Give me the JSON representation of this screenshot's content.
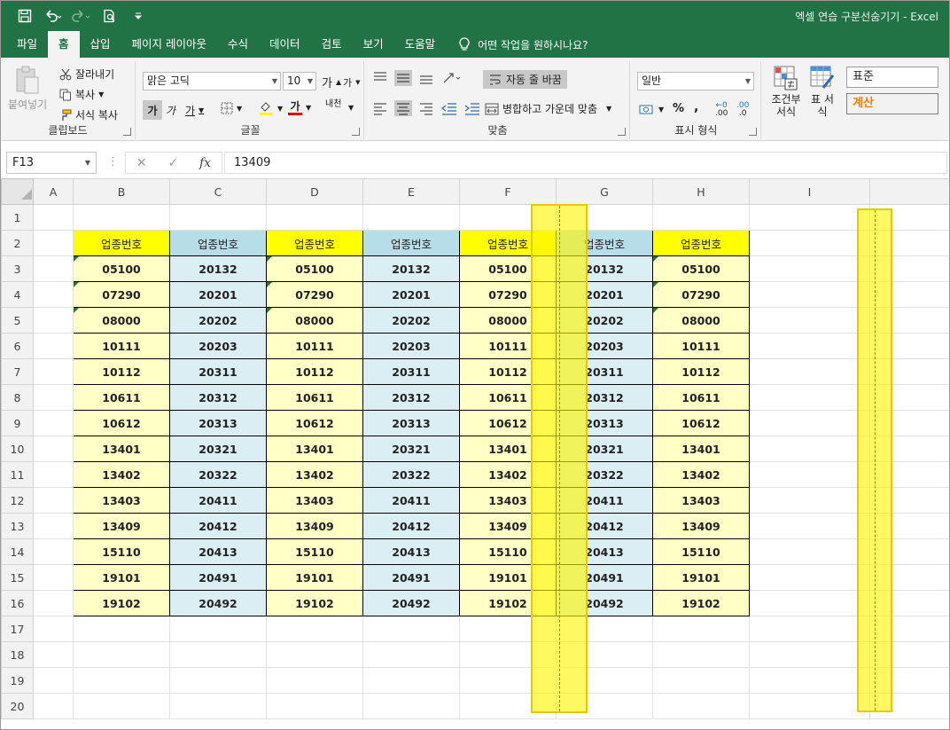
{
  "window": {
    "title": "엑셀 연습 구분선숨기기 - Excel"
  },
  "tabs": [
    {
      "label": "파일"
    },
    {
      "label": "홈",
      "active": true
    },
    {
      "label": "삽입"
    },
    {
      "label": "페이지 레이아웃"
    },
    {
      "label": "수식"
    },
    {
      "label": "데이터"
    },
    {
      "label": "검토"
    },
    {
      "label": "보기"
    },
    {
      "label": "도움말"
    }
  ],
  "tell_me": "어떤 작업을 원하시나요?",
  "ribbon": {
    "clipboard": {
      "label": "클립보드",
      "paste": "붙여넣기",
      "cut": "잘라내기",
      "copy": "복사",
      "format_painter": "서식 복사"
    },
    "font": {
      "label": "글꼴",
      "family": "맑은 고딕",
      "size": "10",
      "grow": "가",
      "shrink": "가",
      "bold": "가",
      "italic": "가",
      "underline": "가",
      "font_color": "가",
      "phonetic": "내천"
    },
    "alignment": {
      "label": "맞춤",
      "wrap": "자동 줄 바꿈",
      "merge": "병합하고 가운데 맞춤"
    },
    "number": {
      "label": "표시 형식",
      "format": "일반",
      "percent": "%",
      "comma": ",",
      "inc_decimal": ".00",
      "dec_decimal": ".0"
    },
    "styles": {
      "conditional": "조건부 서식",
      "table": "표 서식",
      "normal": "표준",
      "calc": "계산"
    }
  },
  "formula_bar": {
    "name_box": "F13",
    "value": "13409"
  },
  "sheet": {
    "columns": [
      "A",
      "B",
      "C",
      "D",
      "E",
      "F",
      "G",
      "H",
      "I"
    ],
    "rows": [
      "1",
      "2",
      "3",
      "4",
      "5",
      "6",
      "7",
      "8",
      "9",
      "10",
      "11",
      "12",
      "13",
      "14",
      "15",
      "16",
      "17",
      "18",
      "19",
      "20"
    ],
    "header": "업종번호",
    "seriesA": [
      "05100",
      "07290",
      "08000",
      "10111",
      "10112",
      "10611",
      "10612",
      "13401",
      "13402",
      "13403",
      "13409",
      "15110",
      "19101",
      "19102"
    ],
    "seriesB": [
      "20132",
      "20201",
      "20202",
      "20203",
      "20311",
      "20312",
      "20313",
      "20321",
      "20322",
      "20411",
      "20412",
      "20413",
      "20491",
      "20492"
    ]
  },
  "colors": {
    "excel_green": "#217346",
    "yellow_header": "#ffff00",
    "blue_header": "#b7dde8",
    "yellow_cell": "#ffffc6",
    "blue_cell": "#daeef3",
    "highlight": "#fff500"
  }
}
